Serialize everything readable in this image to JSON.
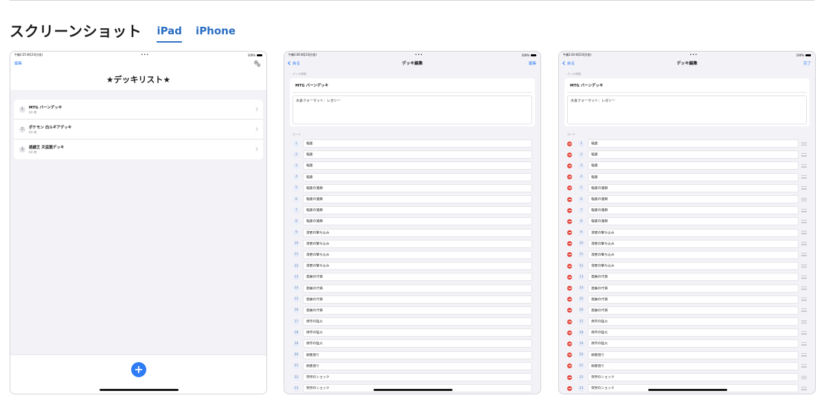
{
  "header": {
    "title": "スクリーンショット",
    "tabs": [
      {
        "label": "iPad",
        "active": true
      },
      {
        "label": "iPhone",
        "active": false
      }
    ]
  },
  "accent_color": "#2f7cf6",
  "shot1": {
    "status": {
      "time": "午後2:25 8月23日(金)",
      "dots": "•••",
      "battery": "100%"
    },
    "edit_label": "編集",
    "gear_icon": "gear-icon",
    "title": "★デッキリスト★",
    "decks": [
      {
        "num": "1",
        "name": "MTG バーンデッキ",
        "count": "60 枚"
      },
      {
        "num": "2",
        "name": "ポケモン 白ルギアデッキ",
        "count": "60 枚"
      },
      {
        "num": "3",
        "name": "遊戯王 天盃龍デッキ",
        "count": "60 枚"
      }
    ],
    "add_label": "+"
  },
  "shot2": {
    "status": {
      "time": "午後2:26 8月23日(金)",
      "dots": "•••",
      "battery": "100%"
    },
    "back_label": "戻る",
    "title": "デッキ編集",
    "right_label": "編集",
    "info_label": "デッキ情報",
    "deck_name": "MTG バーンデッキ",
    "format": "大会フォーマット：レガシー",
    "cards_label": "カード"
  },
  "shot3": {
    "status": {
      "time": "午後2:24 8月23日(金)",
      "dots": "•••",
      "battery": "100%"
    },
    "back_label": "戻る",
    "title": "デッキ編集",
    "right_label": "完了",
    "info_label": "デッキ情報",
    "deck_name": "MTG バーンデッキ",
    "format": "大会フォーマット：レガシー",
    "cards_label": "カード"
  },
  "cards": [
    {
      "num": "1",
      "name": "稲妻"
    },
    {
      "num": "2",
      "name": "稲妻"
    },
    {
      "num": "3",
      "name": "稲妻"
    },
    {
      "num": "4",
      "name": "稲妻"
    },
    {
      "num": "5",
      "name": "稲妻の連鎖"
    },
    {
      "num": "6",
      "name": "稲妻の連鎖"
    },
    {
      "num": "7",
      "name": "稲妻の連鎖"
    },
    {
      "num": "8",
      "name": "稲妻の連鎖"
    },
    {
      "num": "9",
      "name": "溶岩の撃ち込み"
    },
    {
      "num": "10",
      "name": "溶岩の撃ち込み"
    },
    {
      "num": "11",
      "name": "溶岩の撃ち込み"
    },
    {
      "num": "12",
      "name": "溶岩の撃ち込み"
    },
    {
      "num": "13",
      "name": "発展の代価"
    },
    {
      "num": "14",
      "name": "発展の代価"
    },
    {
      "num": "15",
      "name": "発展の代価"
    },
    {
      "num": "16",
      "name": "発展の代価"
    },
    {
      "num": "17",
      "name": "焼尽の猛火"
    },
    {
      "num": "18",
      "name": "焼尽の猛火"
    },
    {
      "num": "19",
      "name": "焼尽の猛火"
    },
    {
      "num": "20",
      "name": "頭蓋割り"
    },
    {
      "num": "21",
      "name": "頭蓋割り"
    },
    {
      "num": "22",
      "name": "突然のショック"
    },
    {
      "num": "23",
      "name": "突然のショック"
    }
  ]
}
